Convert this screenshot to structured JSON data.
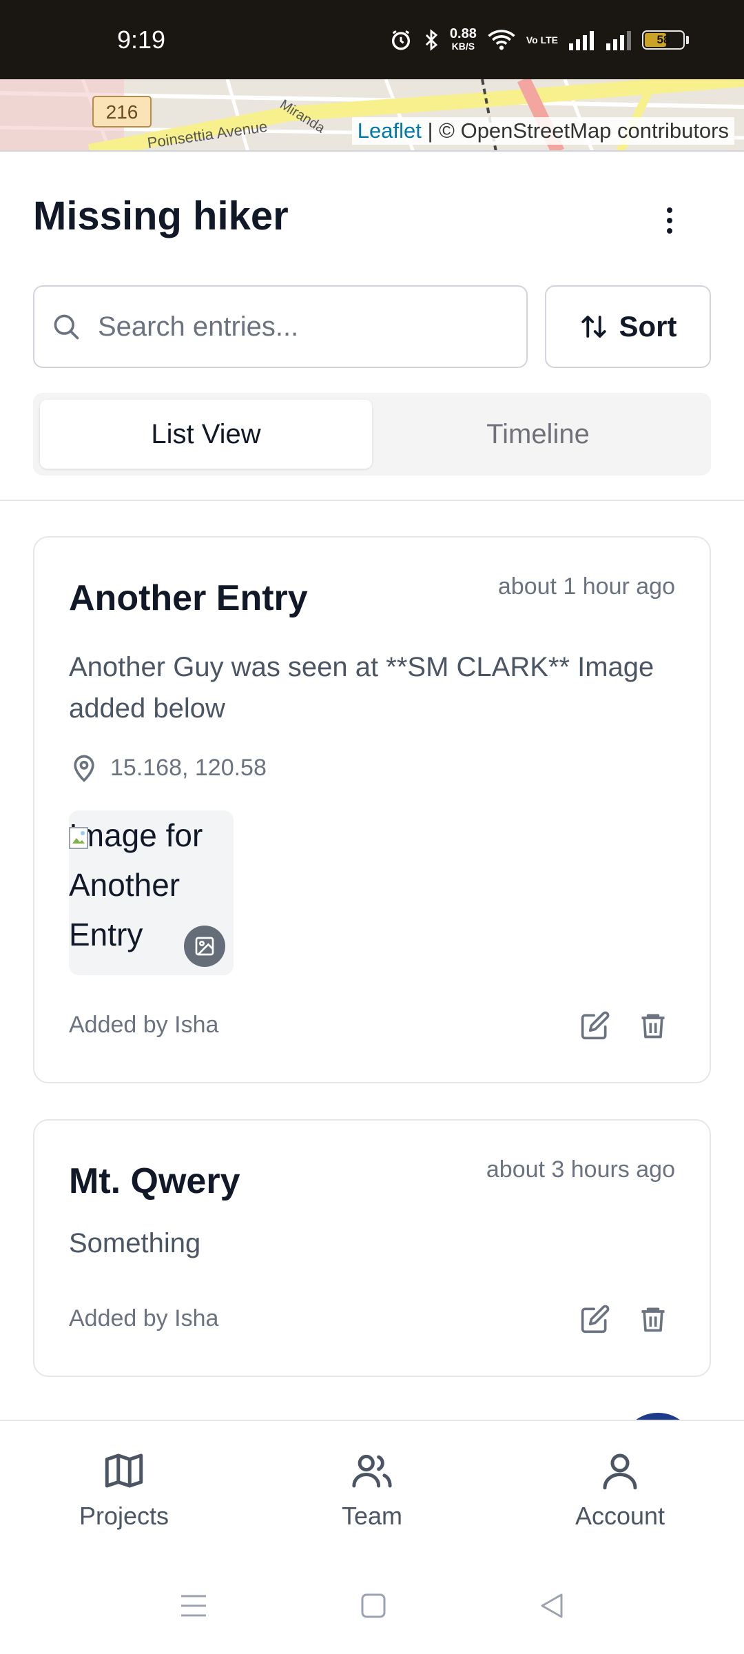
{
  "status_bar": {
    "time": "9:19",
    "net_speed_value": "0.88",
    "net_speed_unit": "KB/S",
    "volte": "Vo LTE",
    "battery_level": "58",
    "icons": [
      "alarm-icon",
      "bluetooth-icon",
      "wifi-icon",
      "signal-icon",
      "signal-icon",
      "battery-icon"
    ]
  },
  "map": {
    "attribution_link": "Leaflet",
    "attribution_rest": " | © OpenStreetMap contributors",
    "route_shield": "216",
    "street_label_1": "Poinsettia Avenue",
    "street_label_2": "Miranda"
  },
  "header": {
    "title": "Missing hiker",
    "menu_icon": "more-vertical-icon"
  },
  "search": {
    "placeholder": "Search entries...",
    "value": "",
    "icon": "search-icon"
  },
  "sort": {
    "label": "Sort",
    "icon": "sort-arrows-icon"
  },
  "tabs": [
    {
      "label": "List View",
      "active": true
    },
    {
      "label": "Timeline",
      "active": false
    }
  ],
  "entries": [
    {
      "title": "Another Entry",
      "time": "about 1 hour ago",
      "description": "Another Guy was seen at **SM CLARK** Image added below",
      "location": "15.168, 120.58",
      "image_alt": "Image for Another Entry",
      "author": "Added by Isha"
    },
    {
      "title": "Mt. Qwery",
      "time": "about 3 hours ago",
      "description": "Something",
      "author": "Added by Isha"
    }
  ],
  "bottom_nav": [
    {
      "label": "Projects",
      "icon": "map-icon"
    },
    {
      "label": "Team",
      "icon": "users-icon"
    },
    {
      "label": "Account",
      "icon": "user-icon"
    }
  ],
  "colors": {
    "status_bar_bg": "#1a1611",
    "text_primary": "#111827",
    "text_secondary": "#6b7280",
    "border": "#e5e7eb",
    "fab": "#1e3a8a",
    "link": "#0078a8"
  }
}
